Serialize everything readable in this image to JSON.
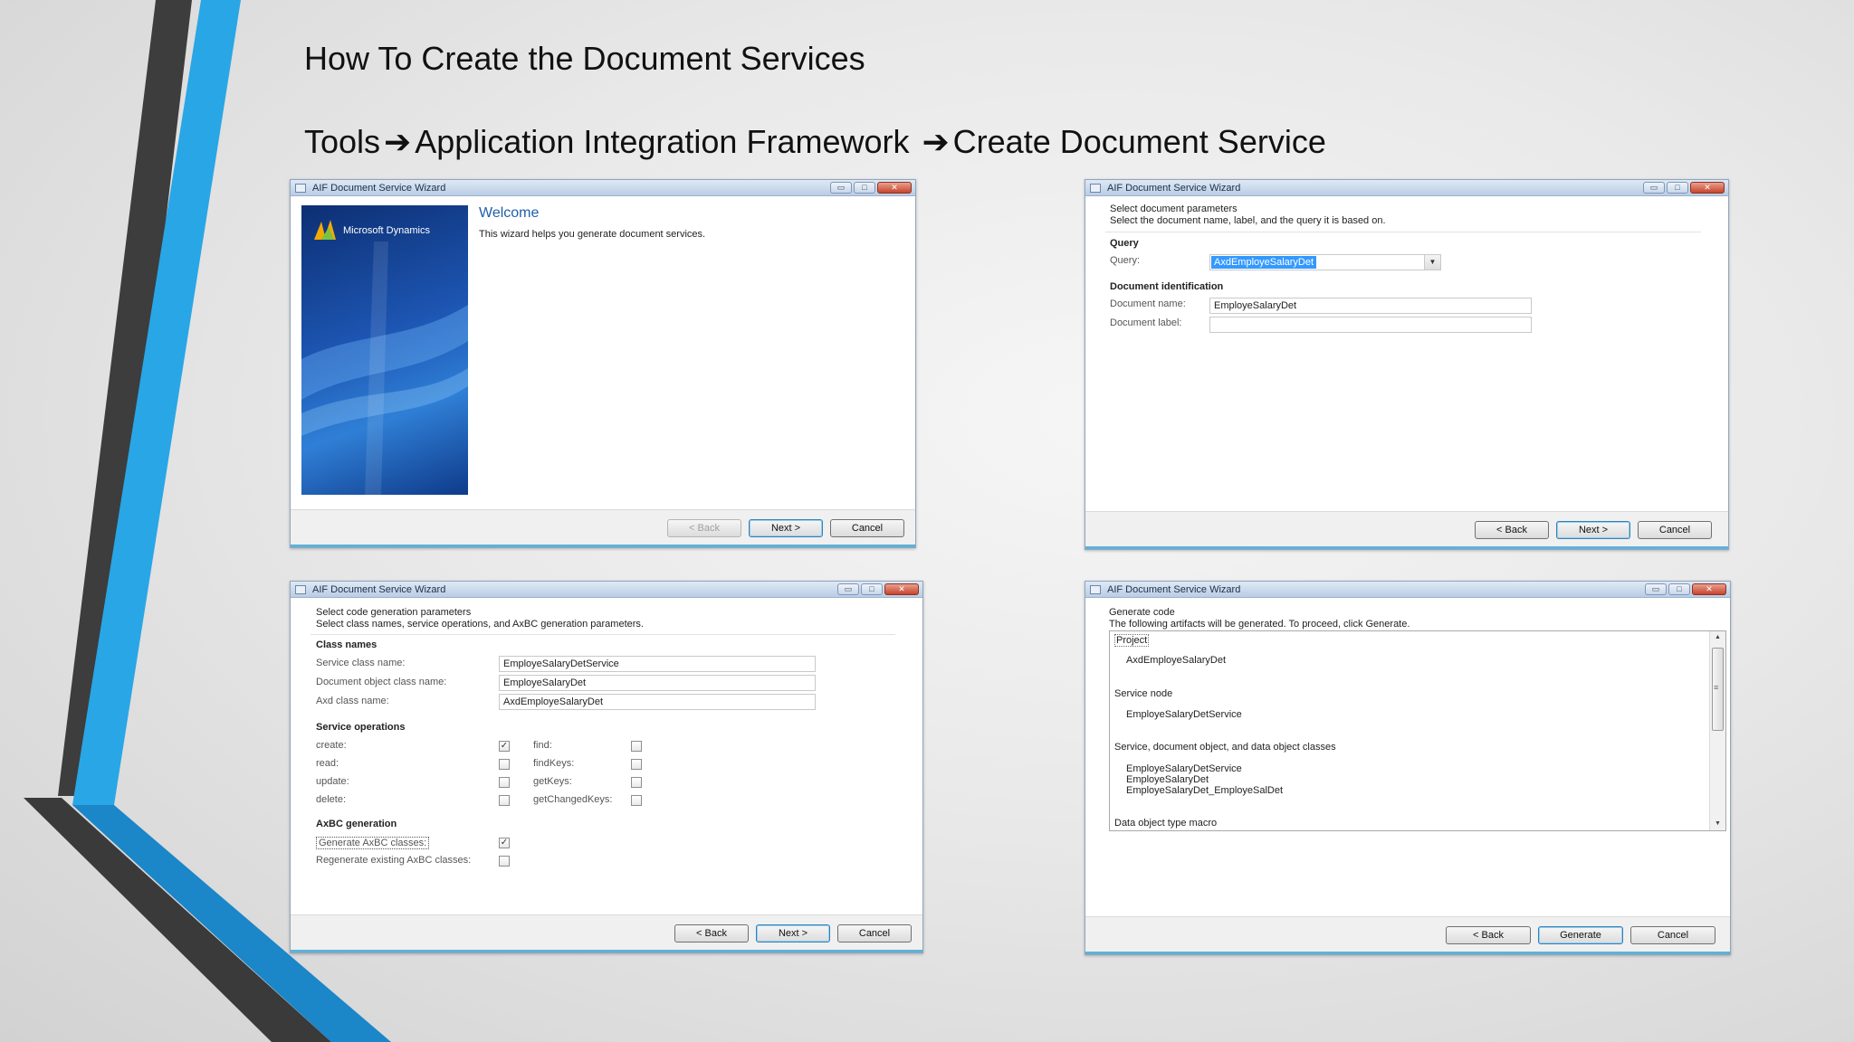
{
  "slide": {
    "title": "How To Create the Document Services",
    "subtitle_parts": [
      "Tools",
      "Application Integration Framework",
      "Create Document Service"
    ],
    "arrow": "➔"
  },
  "colors": {
    "accent_blue": "#29a6e6",
    "dark_stripe": "#3a3a3a",
    "link_blue": "#1e5fa8",
    "selection": "#3399ff"
  },
  "window_title": "AIF Document Service Wizard",
  "window_buttons": {
    "minimize": "▭",
    "maximize": "□",
    "close": "✕"
  },
  "buttons": {
    "back": "< Back",
    "next": "Next >",
    "cancel": "Cancel",
    "generate": "Generate"
  },
  "welcome": {
    "brand": "Microsoft Dynamics",
    "heading": "Welcome",
    "text": "This wizard helps you generate document services."
  },
  "doc_params": {
    "heading": "Select document parameters",
    "subheading": "Select the document name, label, and the query it is based on.",
    "query_section": "Query",
    "query_label": "Query:",
    "query_value": "AxdEmployeSalaryDet",
    "docid_section": "Document identification",
    "doc_name_label": "Document name:",
    "doc_name_value": "EmployeSalaryDet",
    "doc_label_label": "Document label:",
    "doc_label_value": ""
  },
  "code_params": {
    "heading": "Select code generation parameters",
    "subheading": "Select class names, service operations, and AxBC generation parameters.",
    "class_names_section": "Class names",
    "service_class_label": "Service class name:",
    "service_class_value": "EmployeSalaryDetService",
    "doc_object_label": "Document object class name:",
    "doc_object_value": "EmployeSalaryDet",
    "axd_label": "Axd class name:",
    "axd_value": "AxdEmployeSalaryDet",
    "service_ops_section": "Service operations",
    "ops_left": [
      {
        "label": "create:",
        "checked": true
      },
      {
        "label": "read:",
        "checked": false
      },
      {
        "label": "update:",
        "checked": false
      },
      {
        "label": "delete:",
        "checked": false
      }
    ],
    "ops_right": [
      {
        "label": "find:",
        "checked": false
      },
      {
        "label": "findKeys:",
        "checked": false
      },
      {
        "label": "getKeys:",
        "checked": false
      },
      {
        "label": "getChangedKeys:",
        "checked": false
      }
    ],
    "axbc_section": "AxBC generation",
    "generate_axbc_label": "Generate AxBC classes:",
    "generate_axbc_checked": true,
    "regenerate_axbc_label": "Regenerate existing AxBC classes:",
    "regenerate_axbc_checked": false,
    "check_glyph": "✓"
  },
  "generate": {
    "heading": "Generate code",
    "subheading": "The following artifacts will be generated. To proceed, click Generate.",
    "project_header": "Project",
    "project_value": "AxdEmployeSalaryDet",
    "service_node_header": "Service node",
    "service_node_value": "EmployeSalaryDetService",
    "classes_header": "Service, document object, and data object classes",
    "classes": [
      "EmployeSalaryDetService",
      "EmployeSalaryDet",
      "EmployeSalaryDet_EmployeSalDet"
    ],
    "macro_header": "Data object type macro",
    "scroll_up": "▲",
    "scroll_down": "▼",
    "scroll_grip": "≡"
  }
}
